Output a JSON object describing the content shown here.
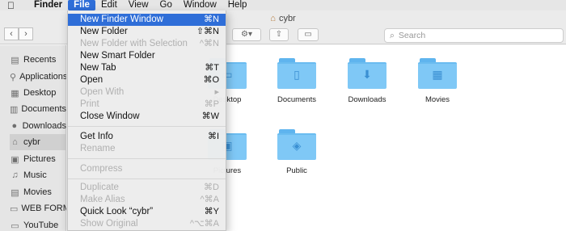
{
  "menubar": {
    "app": "Finder",
    "items": [
      "File",
      "Edit",
      "View",
      "Go",
      "Window",
      "Help"
    ]
  },
  "window": {
    "title": "cybr"
  },
  "search": {
    "placeholder": "Search"
  },
  "sidebar": {
    "items": [
      {
        "label": "Recents",
        "icon": "recents-icon"
      },
      {
        "label": "Applications",
        "icon": "applications-icon"
      },
      {
        "label": "Desktop",
        "icon": "desktop-icon"
      },
      {
        "label": "Documents",
        "icon": "documents-icon"
      },
      {
        "label": "Downloads",
        "icon": "downloads-icon"
      },
      {
        "label": "cybr",
        "icon": "home-icon"
      },
      {
        "label": "Pictures",
        "icon": "pictures-icon"
      },
      {
        "label": "Music",
        "icon": "music-icon"
      },
      {
        "label": "Movies",
        "icon": "movies-icon"
      },
      {
        "label": "WEB FORMS",
        "icon": "folder-icon"
      },
      {
        "label": "YouTube",
        "icon": "folder-icon"
      }
    ]
  },
  "folders": {
    "desktop": "Desktop",
    "documents": "Documents",
    "downloads": "Downloads",
    "movies": "Movies",
    "pictures": "Pictures",
    "public": "Public"
  },
  "file_menu": {
    "new_finder_window": {
      "label": "New Finder Window",
      "shortcut": "⌘N"
    },
    "new_folder": {
      "label": "New Folder",
      "shortcut": "⇧⌘N"
    },
    "new_folder_selection": {
      "label": "New Folder with Selection",
      "shortcut": "^⌘N"
    },
    "new_smart_folder": {
      "label": "New Smart Folder",
      "shortcut": ""
    },
    "new_tab": {
      "label": "New Tab",
      "shortcut": "⌘T"
    },
    "open": {
      "label": "Open",
      "shortcut": "⌘O"
    },
    "open_with": {
      "label": "Open With",
      "shortcut": "▸"
    },
    "print": {
      "label": "Print",
      "shortcut": "⌘P"
    },
    "close_window": {
      "label": "Close Window",
      "shortcut": "⌘W"
    },
    "get_info": {
      "label": "Get Info",
      "shortcut": "⌘I"
    },
    "rename": {
      "label": "Rename",
      "shortcut": ""
    },
    "compress": {
      "label": "Compress",
      "shortcut": ""
    },
    "duplicate": {
      "label": "Duplicate",
      "shortcut": "⌘D"
    },
    "make_alias": {
      "label": "Make Alias",
      "shortcut": "^⌘A"
    },
    "quick_look": {
      "label": "Quick Look “cybr”",
      "shortcut": "⌘Y"
    },
    "show_original": {
      "label": "Show Original",
      "shortcut": "^⌥⌘A"
    }
  }
}
